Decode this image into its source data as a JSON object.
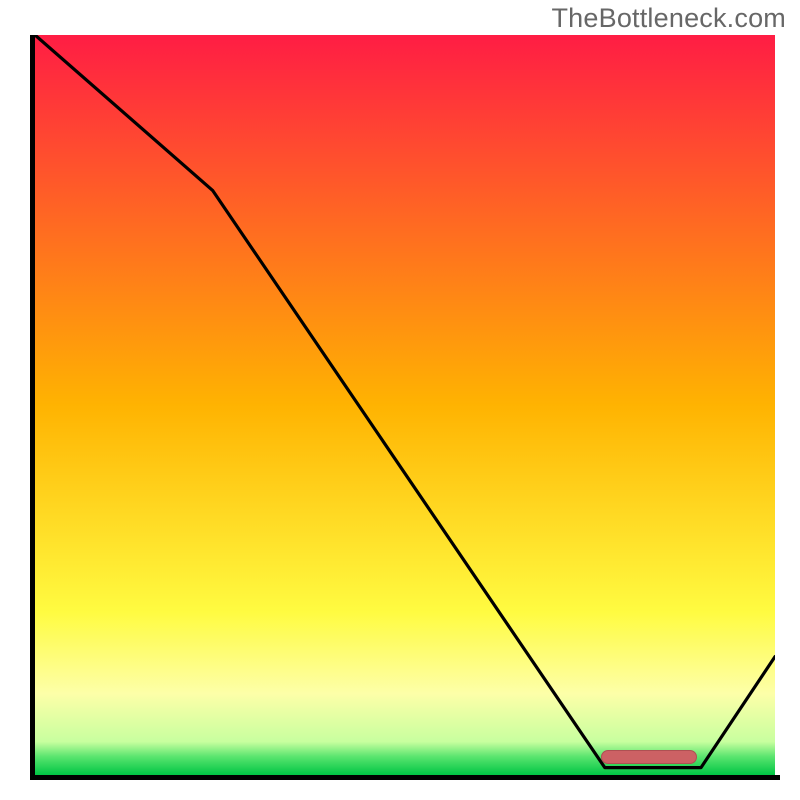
{
  "watermark": "TheBottleneck.com",
  "gradient": {
    "stops": [
      {
        "offset": 0.0,
        "color": "#ff1d44"
      },
      {
        "offset": 0.5,
        "color": "#ffb301"
      },
      {
        "offset": 0.78,
        "color": "#fffb41"
      },
      {
        "offset": 0.89,
        "color": "#fdffa8"
      },
      {
        "offset": 0.955,
        "color": "#c8ff9f"
      },
      {
        "offset": 0.975,
        "color": "#5be56f"
      },
      {
        "offset": 1.0,
        "color": "#00c544"
      }
    ]
  },
  "marker": {
    "x_start": 0.765,
    "x_end": 0.895,
    "y": 0.975
  },
  "chart_data": {
    "type": "line",
    "title": "",
    "xlabel": "",
    "ylabel": "",
    "xlim": [
      0,
      1
    ],
    "ylim": [
      0,
      1
    ],
    "series": [
      {
        "name": "bottleneck-curve",
        "x": [
          0.0,
          0.24,
          0.77,
          0.9,
          1.0
        ],
        "y": [
          1.0,
          0.79,
          0.01,
          0.01,
          0.16
        ]
      }
    ],
    "optimal_region": {
      "x_start": 0.765,
      "x_end": 0.895,
      "severity": 0.0
    },
    "legend": []
  }
}
